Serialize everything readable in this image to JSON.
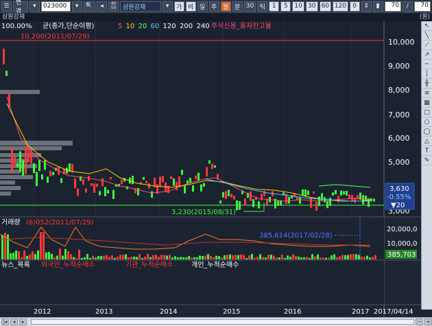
{
  "toolbar": {
    "menu_label": "변경",
    "code": "023000",
    "period_top": "40",
    "period_bottom": "50",
    "stock_name": "삼원강재",
    "buttons": [
      "가",
      "비",
      "일",
      "주",
      "월",
      "분",
      "30",
      "틱",
      "1",
      "5",
      "10",
      "30",
      "60",
      "120",
      "0"
    ],
    "field_a": "70",
    "field_b": "70"
  },
  "title": {
    "name": "삼원강재",
    "unit": "(원)"
  },
  "price_panel": {
    "header": "100.00%",
    "ma_title": "균(종가,단순이평)",
    "ma_periods": [
      "5",
      "10",
      "20",
      "60",
      "120",
      "200",
      "240"
    ],
    "ma_colors": [
      "#ff4d6d",
      "#ffd400",
      "#6cff6c",
      "#4cc4ff",
      "#ffffff",
      "#ffffff",
      "#ffffff"
    ],
    "credit_label": "주식신용_융자잔고율",
    "high_label": "10,200(2011/07/29)",
    "low_label": "3,230(2015/08/31)",
    "axis_labels": [
      "10,000",
      "9,000",
      "8,000",
      "7,000",
      "6,000",
      "5,000",
      "4,000",
      "3,000"
    ],
    "current_price": "3,630",
    "change_pct": "-0.55%",
    "change_abs": "▼20"
  },
  "volume_panel": {
    "header": "거래량",
    "peak_label": "(6)052(2011/07/29)",
    "recent_label": "385,614(2017/02/28)",
    "axis_labels": [
      "20,000,0",
      "10,000,0"
    ],
    "current_volume": "385,703"
  },
  "investor_panel": {
    "labels": [
      "뉴스_목록",
      "외국인_누적순매수",
      "기관_누적순매수",
      "개인_누적순매수"
    ]
  },
  "x_axis": {
    "years": [
      "2012",
      "2013",
      "2014",
      "2015",
      "2016",
      "2017"
    ],
    "end_date": "2017/04/14"
  },
  "colors": {
    "up": "#ff3a3a",
    "down": "#3cff3c",
    "background": "#1e2532"
  }
}
